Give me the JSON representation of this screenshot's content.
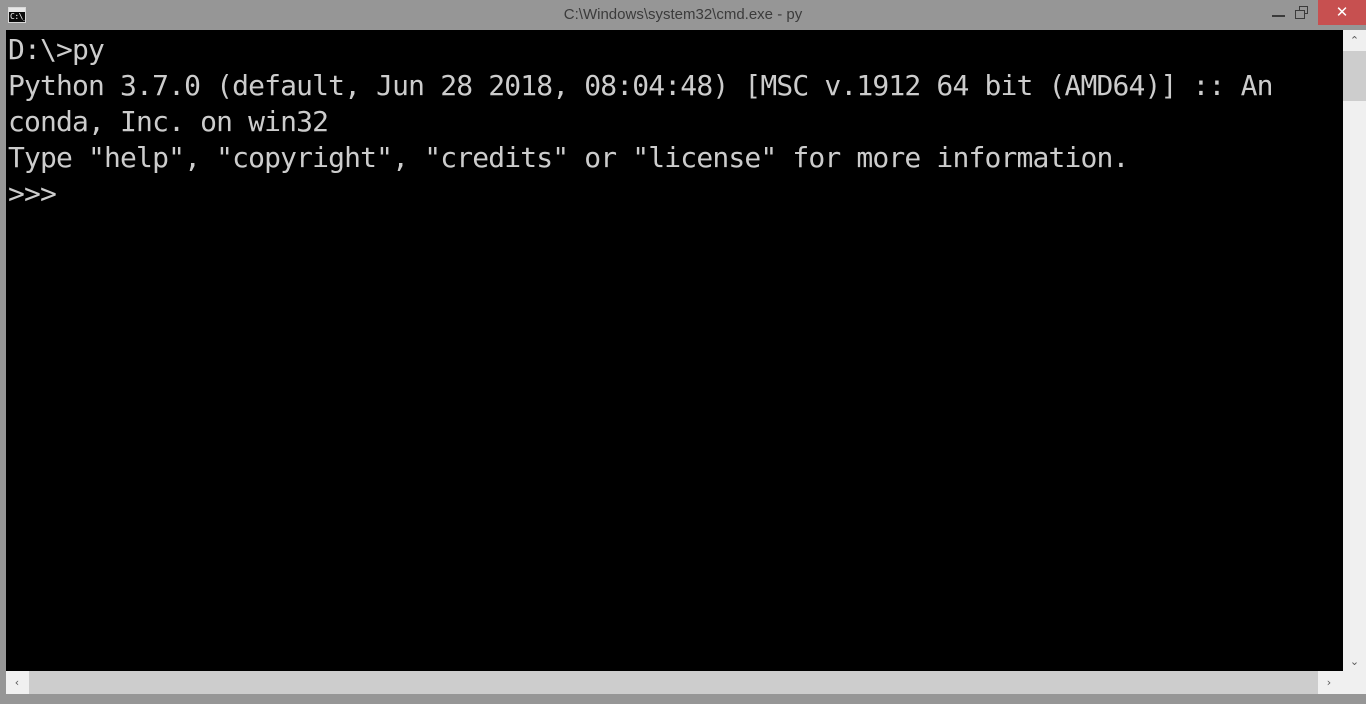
{
  "window": {
    "title": "C:\\Windows\\system32\\cmd.exe - py",
    "icon_name": "cmd-console-icon",
    "icon_glyph": "C:\\_",
    "frame_color": "#969696",
    "console_background": "#000000",
    "console_foreground": "#cccccc",
    "controls": {
      "minimize_label": "–",
      "minimize_name": "minimize-button",
      "restore_label": "❐",
      "restore_name": "restore-button",
      "close_label": "✕",
      "close_name": "close-button",
      "close_color": "#c75050"
    }
  },
  "console": {
    "lines": [
      "D:\\>py",
      "Python 3.7.0 (default, Jun 28 2018, 08:04:48) [MSC v.1912 64 bit (AMD64)] :: An",
      "conda, Inc. on win32",
      "Type \"help\", \"copyright\", \"credits\" or \"license\" for more information.",
      ">>>"
    ],
    "text": "D:\\>py\nPython 3.7.0 (default, Jun 28 2018, 08:04:48) [MSC v.1912 64 bit (AMD64)] :: An\nconda, Inc. on win32\nType \"help\", \"copyright\", \"credits\" or \"license\" for more information.\n>>>",
    "prompt": ">>>",
    "command": "py",
    "cwd": "D:\\"
  },
  "scrollbars": {
    "vertical": {
      "up_arrow": "⌃",
      "down_arrow": "⌄",
      "track_color": "#f0f0f0",
      "thumb_color": "#cdcdcd"
    },
    "horizontal": {
      "left_arrow": "‹",
      "right_arrow": "›",
      "track_color": "#f0f0f0",
      "thumb_color": "#cdcdcd"
    }
  }
}
